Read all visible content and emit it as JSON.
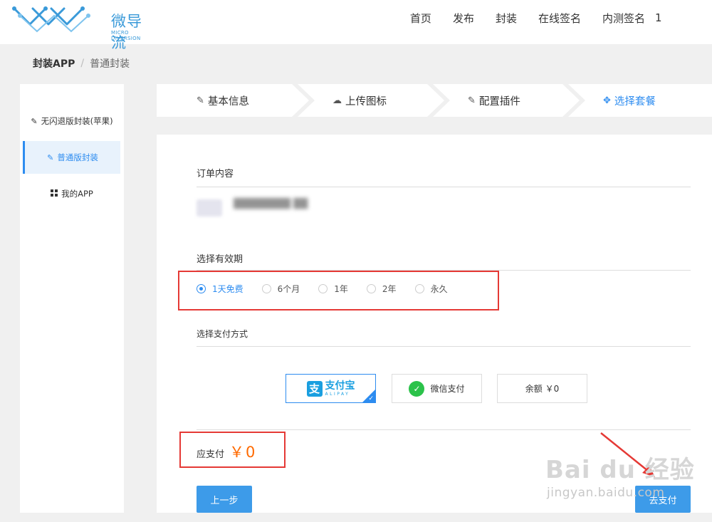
{
  "header": {
    "logo_text": "微导流",
    "logo_sub": "MICRO DIVERSION",
    "nav": [
      "首页",
      "发布",
      "封装",
      "在线签名",
      "内测签名"
    ],
    "user": "1"
  },
  "breadcrumb": {
    "main": "封装APP",
    "sep": "/",
    "sub": "普通封装"
  },
  "sidebar": {
    "items": [
      {
        "icon": "pen-icon",
        "label": "无闪退版封装(苹果)"
      },
      {
        "icon": "edit-icon",
        "label": "普通版封装"
      },
      {
        "icon": "grid-icon",
        "label": "我的APP"
      }
    ]
  },
  "steps": [
    {
      "icon": "pen-icon",
      "label": "基本信息"
    },
    {
      "icon": "cloud-upload-icon",
      "label": "上传图标"
    },
    {
      "icon": "edit-icon",
      "label": "配置插件"
    },
    {
      "icon": "move-icon",
      "label": "选择套餐"
    }
  ],
  "order": {
    "title": "订单内容",
    "name": "████████ ██"
  },
  "validity": {
    "title": "选择有效期",
    "options": [
      "1天免费",
      "6个月",
      "1年",
      "2年",
      "永久"
    ],
    "selected": "1天免费"
  },
  "payment": {
    "title": "选择支付方式",
    "alipay_cn": "支付宝",
    "alipay_en": "ALIPAY",
    "wechat": "微信支付",
    "balance": "余额 ￥0"
  },
  "amount": {
    "label": "应支付",
    "value": "￥0"
  },
  "buttons": {
    "prev": "上一步",
    "next": "去支付"
  },
  "watermark": {
    "brand": "Bai du 经验",
    "url": "jingyan.baidu.com"
  },
  "colors": {
    "accent": "#2d8cf0",
    "price": "#ff6a00",
    "annotation": "#e53935"
  }
}
